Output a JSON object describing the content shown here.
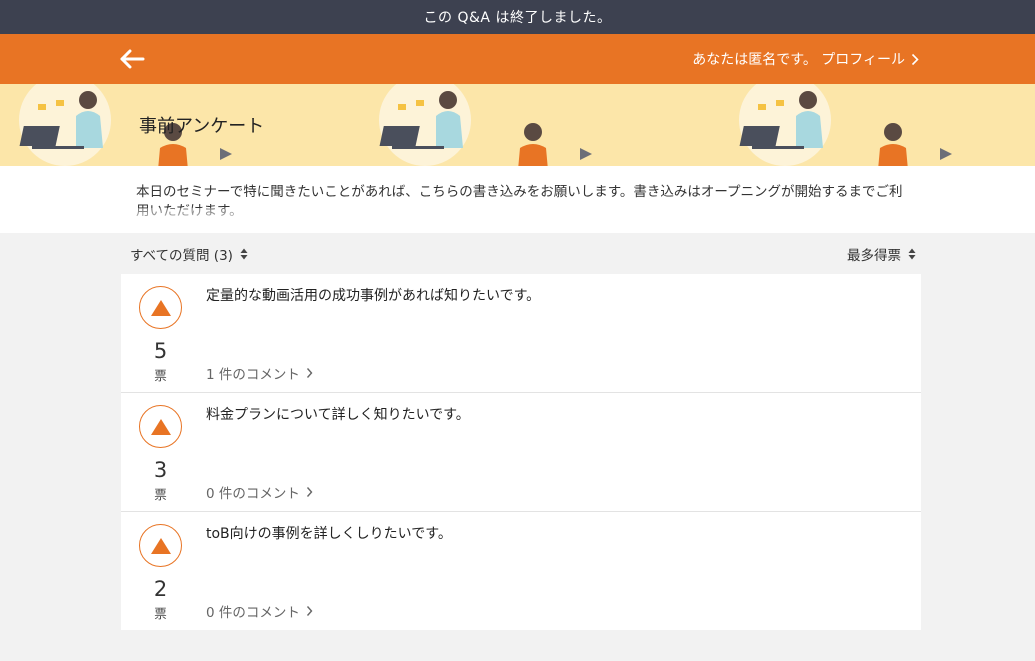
{
  "notice": "この Q&A は終了しました。",
  "header": {
    "profile_link": "あなたは匿名です。 プロフィール"
  },
  "banner": {
    "title": "事前アンケート"
  },
  "description": "本日のセミナーで特に聞きたいことがあれば、こちらの書き込みをお願いします。書き込みはオープニングが開始するまでご利用いただけます。",
  "toolbar": {
    "filter_label": "すべての質問 (3)",
    "sort_label": "最多得票"
  },
  "questions": [
    {
      "text": "定量的な動画活用の成功事例があれば知りたいです。",
      "votes": "5",
      "vote_unit": "票",
      "comments": "1 件のコメント"
    },
    {
      "text": "料金プランについて詳しく知りたいです。",
      "votes": "3",
      "vote_unit": "票",
      "comments": "0 件のコメント"
    },
    {
      "text": "toB向けの事例を詳しくしりたいです。",
      "votes": "2",
      "vote_unit": "票",
      "comments": "0 件のコメント"
    }
  ],
  "colors": {
    "accent": "#e87424",
    "topbar": "#3d4150",
    "banner": "#fce6a9"
  }
}
